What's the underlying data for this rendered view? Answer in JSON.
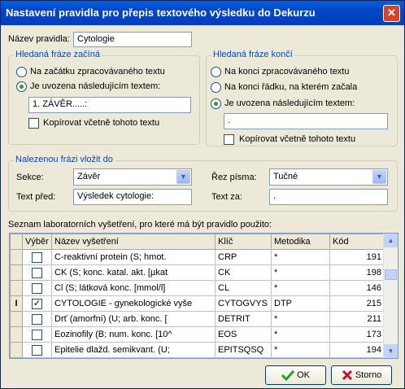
{
  "window": {
    "title": "Nastavení pravidla pro přepis textového výsledku do Dekurzu"
  },
  "rule_name": {
    "label": "Název pravidla:",
    "value": "Cytologie"
  },
  "start_group": {
    "legend": "Hledaná fráze začíná",
    "opt1": "Na začátku zpracovávaného textu",
    "opt2": "Je uvozena následujícím textem:",
    "selected": 2,
    "value": "1. ZÁVĚR.....:",
    "copy_label": "Kopírovat včetně tohoto textu",
    "copy_checked": false
  },
  "end_group": {
    "legend": "Hledaná fráze končí",
    "opt1": "Na konci zpracovávaného textu",
    "opt2": "Na konci řádku, na kterém začala",
    "opt3": "Je uvozena následujícím textem:",
    "selected": 3,
    "value": ".",
    "copy_label": "Kopírovat včetně tohoto textu",
    "copy_checked": false
  },
  "insert_group": {
    "legend": "Nalezenou frázi vložit do",
    "section_label": "Sekce:",
    "section_value": "Závěr",
    "font_label": "Řez písma:",
    "font_value": "Tučné",
    "before_label": "Text před:",
    "before_value": "Výsledek cytologie:",
    "after_label": "Text za:",
    "after_value": "."
  },
  "list": {
    "caption": "Seznam laboratorních vyšetření, pro které má být pravidlo použito:",
    "columns": [
      "Výběr",
      "Název vyšetření",
      "Klíč",
      "Metodika",
      "Kód"
    ],
    "rows": [
      {
        "checked": false,
        "name": "C-reaktivní protein (S; hmot.",
        "key": "CRP",
        "method": "*",
        "code": "191"
      },
      {
        "checked": false,
        "name": "CK (S; konc. katal. akt. [µkat",
        "key": "CK",
        "method": "*",
        "code": "198"
      },
      {
        "checked": false,
        "name": "Cl (S; látková konc. [mmol/l]",
        "key": "CL",
        "method": "*",
        "code": "146"
      },
      {
        "checked": true,
        "name": "CYTOLOGIE - gynekologické vyše",
        "key": "CYTOGVYS",
        "method": "DTP",
        "code": "215",
        "current": true
      },
      {
        "checked": false,
        "name": "Drť (amorfní) (U; arb. konc. [",
        "key": "DETRIT",
        "method": "*",
        "code": "211"
      },
      {
        "checked": false,
        "name": "Eozinofily (B; num. konc. [10^",
        "key": "EOS",
        "method": "*",
        "code": "173"
      },
      {
        "checked": false,
        "name": "Epitelie dlažd. semikvant. (U;",
        "key": "EPITSQSQ",
        "method": "*",
        "code": "194"
      }
    ]
  },
  "buttons": {
    "ok": "OK",
    "cancel": "Storno"
  },
  "colors": {
    "title_bar": "#0047c8",
    "group_legend": "#0046d5",
    "ok_icon": "#2a9d2a",
    "cancel_icon": "#c8102e"
  }
}
